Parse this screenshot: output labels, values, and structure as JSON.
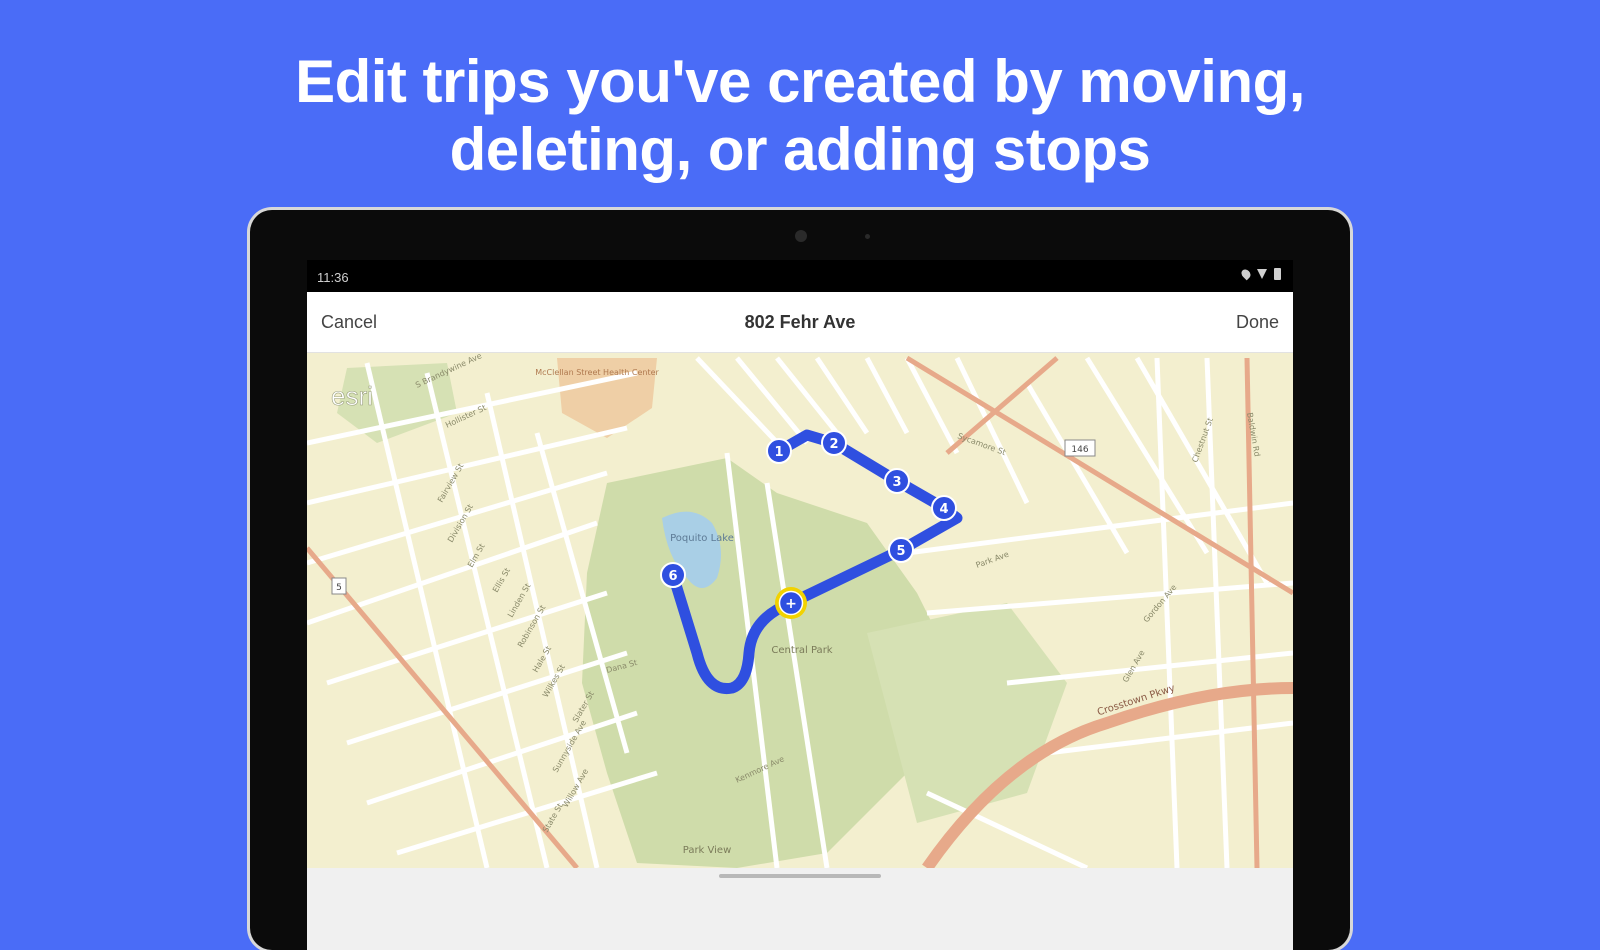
{
  "headline": {
    "line1": "Edit trips you've created by moving,",
    "line2": "deleting, or adding stops"
  },
  "status_bar": {
    "time": "11:36",
    "icons": [
      "location-icon",
      "wifi-icon",
      "battery-icon"
    ]
  },
  "app_bar": {
    "cancel_label": "Cancel",
    "title": "802 Fehr Ave",
    "done_label": "Done"
  },
  "map": {
    "attribution": "esri",
    "park_label": "Central Park",
    "lake_label": "Poquito Lake",
    "bottom_label": "Park View",
    "top_place": "McClellan Street Health Center",
    "highway_label": "Crosstown Pkwy",
    "road_labels": [
      "S Brandywine Ave",
      "Hollister St",
      "Fairview St",
      "Division St",
      "Elm St",
      "Ellis St",
      "Linden St",
      "Robinson St",
      "Hale St",
      "Wilkes St",
      "Slater St",
      "Dana St",
      "Sunnyside Ave",
      "Willow Ave",
      "State St",
      "Kenmore Ave",
      "Sycamore St",
      "Park Ave",
      "Glen Ave",
      "Chestnut St",
      "Gordon Ave",
      "Baldwin Rd"
    ],
    "route_shields": [
      "146",
      "5"
    ],
    "stops": [
      "1",
      "2",
      "3",
      "4",
      "5",
      "6"
    ],
    "add_stop_label": "+"
  },
  "colors": {
    "background": "#4a6cf7",
    "route": "#2f4fe0",
    "add_stop_ring": "#f2d200",
    "map_base": "#f3efcf",
    "park": "#cfdcaa",
    "road_major": "#e7a98a"
  }
}
